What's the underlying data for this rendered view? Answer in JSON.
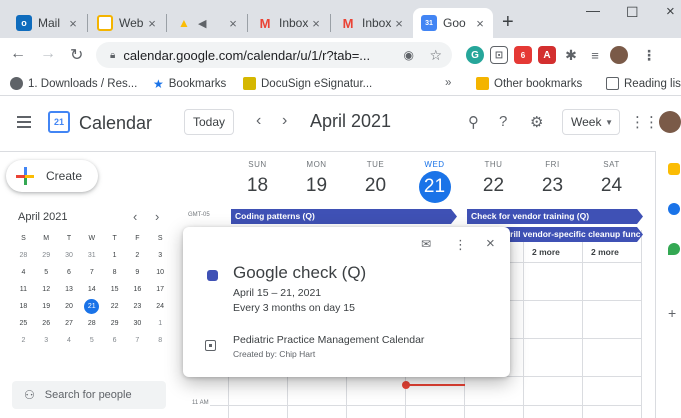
{
  "browser": {
    "tabs": [
      {
        "label": "Mail",
        "icon": "outlook-icon",
        "color": "#0f6cbd",
        "glyph": "o",
        "active": false
      },
      {
        "label": "Web",
        "icon": "web-icon",
        "color": "#f4b400",
        "glyph": "",
        "active": false
      },
      {
        "label": "",
        "icon": "drive-icon",
        "color": "#fbbc04",
        "glyph": "▲",
        "active": false
      },
      {
        "label": "Inbox",
        "icon": "gmail-icon",
        "color": "#ea4335",
        "glyph": "M",
        "active": false
      },
      {
        "label": "Inbox",
        "icon": "gmail-icon",
        "color": "#ea4335",
        "glyph": "M",
        "active": false
      },
      {
        "label": "Goo",
        "icon": "calendar-icon",
        "color": "#4285f4",
        "glyph": "31",
        "active": true
      }
    ],
    "close_glyph": "×",
    "new_tab": "+",
    "url": "calendar.google.com/calendar/u/1/r?tab=...",
    "bookmarks": [
      {
        "label": "1. Downloads / Res...",
        "icon": "globe-icon",
        "color": "#5f6368"
      },
      {
        "label": "Bookmarks",
        "icon": "star-icon",
        "color": "#1a73e8"
      },
      {
        "label": "DocuSign eSignatur...",
        "icon": "docusign-icon",
        "color": "#d5b700"
      },
      {
        "label": "Other bookmarks",
        "icon": "folder-icon",
        "color": "#f4b400"
      },
      {
        "label": "Reading list",
        "icon": "reading-list-icon",
        "color": "#5f6368"
      }
    ],
    "bookmarks_overflow": "»"
  },
  "header": {
    "app_title": "Calendar",
    "logo_text": "21",
    "today_label": "Today",
    "month_title": "April 2021",
    "view_label": "Week"
  },
  "sidebar": {
    "create_label": "Create",
    "mini_title": "April 2021",
    "weekday_initials": [
      "S",
      "M",
      "T",
      "W",
      "T",
      "F",
      "S"
    ],
    "weeks": [
      [
        "28",
        "29",
        "30",
        "31",
        "1",
        "2",
        "3"
      ],
      [
        "4",
        "5",
        "6",
        "7",
        "8",
        "9",
        "10"
      ],
      [
        "11",
        "12",
        "13",
        "14",
        "15",
        "16",
        "17"
      ],
      [
        "18",
        "19",
        "20",
        "21",
        "22",
        "23",
        "24"
      ],
      [
        "25",
        "26",
        "27",
        "28",
        "29",
        "30",
        "1"
      ],
      [
        "2",
        "3",
        "4",
        "5",
        "6",
        "7",
        "8"
      ]
    ],
    "search_placeholder": "Search for people"
  },
  "week": {
    "timezone": "GMT-05",
    "days": [
      {
        "name": "SUN",
        "date": "18"
      },
      {
        "name": "MON",
        "date": "19"
      },
      {
        "name": "TUE",
        "date": "20"
      },
      {
        "name": "WED",
        "date": "21",
        "today": true
      },
      {
        "name": "THU",
        "date": "22"
      },
      {
        "name": "FRI",
        "date": "23"
      },
      {
        "name": "SAT",
        "date": "24"
      }
    ],
    "allday_events": [
      {
        "title": "Coding patterns (Q)",
        "color": "#3f51b5"
      },
      {
        "title": "Check for vendor training (Q)",
        "color": "#3f51b5"
      },
      {
        "title": "Drill vendor-specific cleanup func",
        "color": "#3f51b5"
      }
    ],
    "more_labels": [
      "2 more",
      "2 more"
    ],
    "hour_label": "11 AM"
  },
  "popup": {
    "title": "Google check (Q)",
    "date_range": "April 15 – 21, 2021",
    "recurrence": "Every 3 months on day 15",
    "calendar_name": "Pediatric Practice Management Calendar",
    "creator": "Created by: Chip Hart",
    "color": "#3f51b5"
  },
  "colors": {
    "accent": "#1a73e8",
    "now_line": "#ea4335"
  }
}
